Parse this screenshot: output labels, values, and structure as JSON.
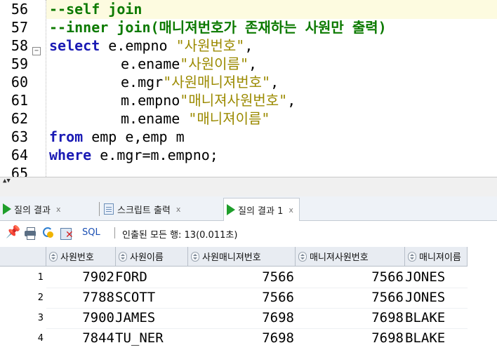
{
  "editor": {
    "lines": [
      {
        "num": "56",
        "text": "--self join"
      },
      {
        "num": "57",
        "text": "--inner join(매니져번호가 존재하는 사원만 출력)"
      },
      {
        "num": "58",
        "text_kw": "select",
        "text_rest": " e.empno ",
        "text_str": "\"사원번호\"",
        "text_tail": ","
      },
      {
        "num": "59",
        "text_rest": "e.ename",
        "text_str": "\"사원이름\"",
        "text_tail": ","
      },
      {
        "num": "60",
        "text_rest": "e.mgr",
        "text_str": "\"사원매니져번호\"",
        "text_tail": ","
      },
      {
        "num": "61",
        "text_rest": "m.empno",
        "text_str": "\"매니져사원번호\"",
        "text_tail": ","
      },
      {
        "num": "62",
        "text_rest": "m.ename ",
        "text_str": "\"매니져이름\"",
        "text_tail": ""
      },
      {
        "num": "63",
        "text_kw": "from",
        "text_rest": " emp e,emp m"
      },
      {
        "num": "64",
        "text_kw": "where",
        "text_rest": " e.mgr=m.empno;"
      },
      {
        "num": "65"
      }
    ]
  },
  "tabs": [
    {
      "label": "질의 결과",
      "close": "x",
      "icon": "play-icon"
    },
    {
      "label": "스크립트 출력",
      "close": "x",
      "icon": "script-icon"
    },
    {
      "label": "질의 결과 1",
      "close": "x",
      "icon": "play-icon"
    }
  ],
  "toolbar": {
    "sql_label": "SQL",
    "status": "인출된 모든 행: 13(0.011초)"
  },
  "grid": {
    "columns": [
      "사원번호",
      "사원이름",
      "사원매니져번호",
      "매니져사원번호",
      "매니져이름"
    ],
    "rows": [
      {
        "n": "1",
        "c": [
          "7902",
          "FORD",
          "7566",
          "7566",
          "JONES"
        ]
      },
      {
        "n": "2",
        "c": [
          "7788",
          "SCOTT",
          "7566",
          "7566",
          "JONES"
        ]
      },
      {
        "n": "3",
        "c": [
          "7900",
          "JAMES",
          "7698",
          "7698",
          "BLAKE"
        ]
      },
      {
        "n": "4",
        "c": [
          "7844",
          "TU_NER",
          "7698",
          "7698",
          "BLAKE"
        ]
      }
    ]
  },
  "colors": {
    "comment": "#0c7a00",
    "keyword": "#1a1ab4",
    "string": "#9b8a00",
    "active_line": "#fdfbe0"
  }
}
